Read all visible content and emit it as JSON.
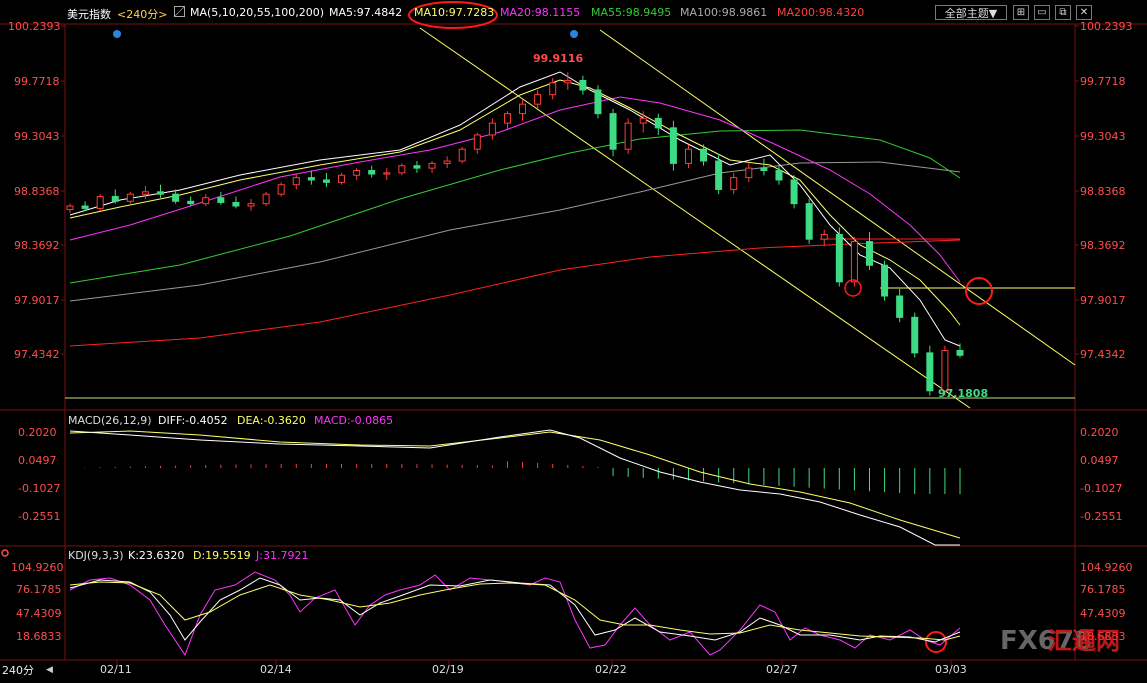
{
  "header": {
    "symbol": "美元指数",
    "period": "<240分>",
    "ma_params": "MA(5,10,20,55,100,200)",
    "ma5": "MA5:97.4842",
    "ma10": "MA10:97.7283",
    "ma20": "MA20:98.1155",
    "ma55": "MA55:98.9495",
    "ma100": "MA100:98.9861",
    "ma200": "MA200:98.4320",
    "theme_label": "全部主题▼"
  },
  "colors": {
    "up": "#ff3b3b",
    "down": "#3ddc84",
    "ma5": "#ffffff",
    "ma10": "#ffff66",
    "ma20": "#ff33ff",
    "ma55": "#33cc33",
    "ma100": "#999999",
    "ma200": "#ff2222",
    "axis_label": "#ff4d4d",
    "channel": "#ffff66"
  },
  "icons": [
    "chart-icon",
    "expand-icon",
    "minimize-icon",
    "restore-icon",
    "close-icon"
  ],
  "price_axis": [
    "100.2393",
    "99.7718",
    "99.3043",
    "98.8368",
    "98.3692",
    "97.9017",
    "97.4342"
  ],
  "annotations": {
    "high": "99.9116",
    "low": "97.1808"
  },
  "macd": {
    "label": "MACD(26,12,9)",
    "diff": "DIFF:-0.4052",
    "dea": "DEA:-0.3620",
    "macd": "MACD:-0.0865",
    "axis": [
      "0.2020",
      "0.0497",
      "-0.1027",
      "-0.2551"
    ]
  },
  "kdj": {
    "label": "KDJ(9,3,3)",
    "k": "K:23.6320",
    "d": "D:19.5519",
    "j": "J:31.7921",
    "axis": [
      "104.9260",
      "76.1785",
      "47.4309",
      "18.6833"
    ]
  },
  "dates": [
    "02/11",
    "02/14",
    "02/19",
    "02/22",
    "02/27",
    "03/03"
  ],
  "period_tab": "240分",
  "watermark": {
    "brand": "FX678",
    "cn": "汇通网"
  },
  "chart_data": {
    "type": "candlestick",
    "title": "美元指数",
    "price_range": [
      97.1,
      100.3
    ],
    "candles_approx": [
      [
        98.75,
        98.8,
        98.72,
        98.78
      ],
      [
        98.78,
        98.82,
        98.74,
        98.76
      ],
      [
        98.76,
        98.88,
        98.74,
        98.86
      ],
      [
        98.86,
        98.92,
        98.8,
        98.82
      ],
      [
        98.82,
        98.9,
        98.8,
        98.88
      ],
      [
        98.88,
        98.95,
        98.84,
        98.9
      ],
      [
        98.9,
        98.96,
        98.85,
        98.88
      ],
      [
        98.88,
        98.92,
        98.8,
        98.82
      ],
      [
        98.82,
        98.86,
        98.78,
        98.8
      ],
      [
        98.8,
        98.88,
        98.78,
        98.85
      ],
      [
        98.85,
        98.9,
        98.79,
        98.81
      ],
      [
        98.81,
        98.86,
        98.76,
        98.78
      ],
      [
        98.78,
        98.84,
        98.74,
        98.8
      ],
      [
        98.8,
        98.9,
        98.78,
        98.88
      ],
      [
        98.88,
        98.98,
        98.86,
        98.96
      ],
      [
        98.96,
        99.05,
        98.92,
        99.02
      ],
      [
        99.02,
        99.08,
        98.96,
        99.0
      ],
      [
        99.0,
        99.06,
        98.94,
        98.98
      ],
      [
        98.98,
        99.06,
        98.96,
        99.04
      ],
      [
        99.04,
        99.1,
        99.0,
        99.08
      ],
      [
        99.08,
        99.12,
        99.02,
        99.05
      ],
      [
        99.05,
        99.1,
        99.0,
        99.06
      ],
      [
        99.06,
        99.14,
        99.04,
        99.12
      ],
      [
        99.12,
        99.16,
        99.06,
        99.1
      ],
      [
        99.1,
        99.16,
        99.06,
        99.14
      ],
      [
        99.14,
        99.2,
        99.1,
        99.16
      ],
      [
        99.16,
        99.28,
        99.14,
        99.26
      ],
      [
        99.26,
        99.4,
        99.22,
        99.38
      ],
      [
        99.38,
        99.52,
        99.34,
        99.48
      ],
      [
        99.48,
        99.58,
        99.42,
        99.56
      ],
      [
        99.56,
        99.68,
        99.5,
        99.64
      ],
      [
        99.64,
        99.76,
        99.6,
        99.72
      ],
      [
        99.72,
        99.86,
        99.68,
        99.82
      ],
      [
        99.82,
        99.91,
        99.76,
        99.84
      ],
      [
        99.84,
        99.88,
        99.72,
        99.76
      ],
      [
        99.76,
        99.8,
        99.52,
        99.56
      ],
      [
        99.56,
        99.6,
        99.2,
        99.26
      ],
      [
        99.26,
        99.52,
        99.22,
        99.48
      ],
      [
        99.48,
        99.58,
        99.4,
        99.52
      ],
      [
        99.52,
        99.56,
        99.38,
        99.44
      ],
      [
        99.44,
        99.5,
        99.08,
        99.14
      ],
      [
        99.14,
        99.3,
        99.1,
        99.26
      ],
      [
        99.26,
        99.3,
        99.12,
        99.16
      ],
      [
        99.16,
        99.22,
        98.88,
        98.92
      ],
      [
        98.92,
        99.06,
        98.88,
        99.02
      ],
      [
        99.02,
        99.14,
        98.98,
        99.1
      ],
      [
        99.1,
        99.18,
        99.04,
        99.08
      ],
      [
        99.08,
        99.12,
        98.96,
        99.0
      ],
      [
        99.0,
        99.04,
        98.76,
        98.8
      ],
      [
        98.8,
        98.84,
        98.46,
        98.5
      ],
      [
        98.5,
        98.58,
        98.44,
        98.54
      ],
      [
        98.54,
        98.6,
        98.1,
        98.14
      ],
      [
        98.14,
        98.52,
        98.1,
        98.48
      ],
      [
        98.48,
        98.56,
        98.24,
        98.28
      ],
      [
        98.28,
        98.32,
        97.98,
        98.02
      ],
      [
        98.02,
        98.08,
        97.8,
        97.84
      ],
      [
        97.84,
        97.88,
        97.5,
        97.54
      ],
      [
        97.54,
        97.6,
        97.18,
        97.22
      ],
      [
        97.22,
        97.6,
        97.18,
        97.56
      ],
      [
        97.56,
        97.62,
        97.5,
        97.52
      ]
    ]
  }
}
